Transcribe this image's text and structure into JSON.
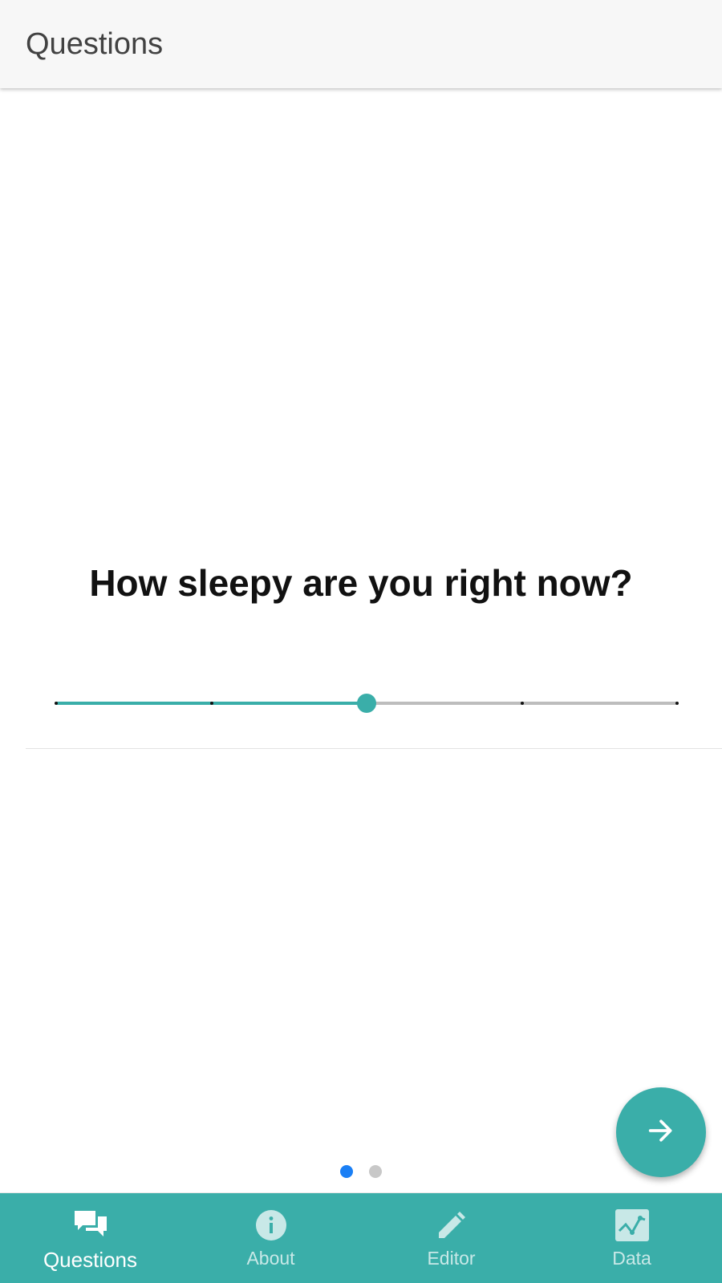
{
  "header": {
    "title": "Questions"
  },
  "question": {
    "text": "How sleepy are you right now?",
    "slider": {
      "steps": 5,
      "value_index": 2
    }
  },
  "pager": {
    "count": 2,
    "active": 0
  },
  "fab": {
    "icon": "arrow-right-icon"
  },
  "bottom_nav": {
    "items": [
      {
        "label": "Questions",
        "icon": "chat-bubbles-icon",
        "active": true
      },
      {
        "label": "About",
        "icon": "info-icon",
        "active": false
      },
      {
        "label": "Editor",
        "icon": "pencil-icon",
        "active": false
      },
      {
        "label": "Data",
        "icon": "chart-icon",
        "active": false
      }
    ]
  },
  "colors": {
    "accent": "#3aaea9",
    "header_bg": "#f7f7f7",
    "dot_active": "#1a7ff5",
    "dot_inactive": "#c8c8c8",
    "track_inactive": "#bdbdbd"
  }
}
